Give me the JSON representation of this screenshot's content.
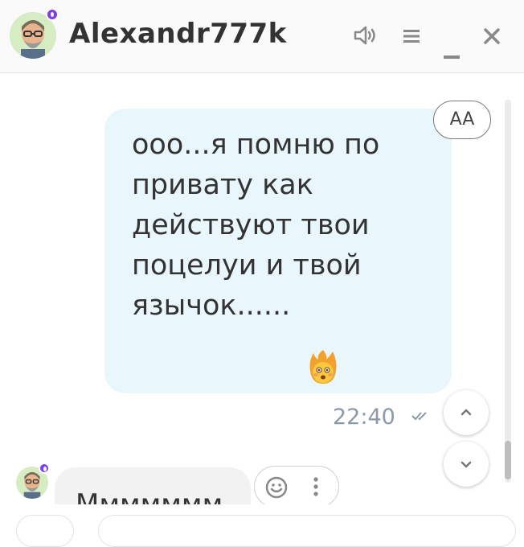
{
  "header": {
    "title": "Alexandr777k",
    "icons": [
      "speaker-icon",
      "menu-icon",
      "minimize-icon",
      "close-icon"
    ]
  },
  "messages": {
    "outgoing": {
      "text": "ооо...я помню по\nпривату как\nдействуют твои\nпоцелуи и твой\nязычок......",
      "emoji": "fire-face-emoji",
      "time": "22:40",
      "status": "read-double-check"
    },
    "incoming": {
      "text": "Ммммммм"
    }
  },
  "controls": {
    "font_size_button": "AA"
  },
  "colors": {
    "outgoing_bubble": "#e9f7fc",
    "incoming_bubble": "#f2f2f2",
    "online_badge": "#7b3fe4",
    "time_text": "#8a9aa8"
  }
}
